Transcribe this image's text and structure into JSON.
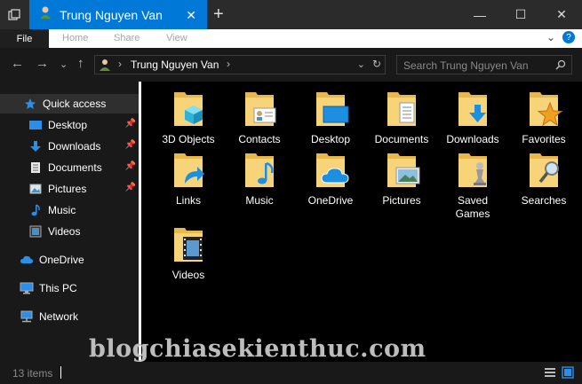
{
  "window": {
    "tab_title": "Trung Nguyen Van",
    "tab_close": "✕",
    "new_tab": "+",
    "minimize": "—",
    "maximize": "☐",
    "close": "✕"
  },
  "ribbon": {
    "file": "File",
    "home": "Home",
    "share": "Share",
    "view": "View",
    "expand_glyph": "⌄",
    "help_glyph": "?"
  },
  "navigation": {
    "back": "←",
    "forward": "→",
    "recent": "⌄",
    "up": "↑",
    "address_path": "Trung Nguyen Van",
    "address_chevron": "›",
    "search_placeholder": "Search Trung Nguyen Van"
  },
  "sidebar": {
    "items": [
      {
        "label": "Quick access",
        "icon": "star-icon"
      },
      {
        "label": "Desktop",
        "icon": "desktop-icon",
        "pinned": true
      },
      {
        "label": "Downloads",
        "icon": "download-icon",
        "pinned": true
      },
      {
        "label": "Documents",
        "icon": "document-icon",
        "pinned": true
      },
      {
        "label": "Pictures",
        "icon": "picture-icon",
        "pinned": true
      },
      {
        "label": "Music",
        "icon": "music-icon"
      },
      {
        "label": "Videos",
        "icon": "video-icon"
      },
      {
        "label": "OneDrive",
        "icon": "cloud-icon"
      },
      {
        "label": "This PC",
        "icon": "computer-icon"
      },
      {
        "label": "Network",
        "icon": "network-icon"
      }
    ]
  },
  "content": {
    "items": [
      {
        "label": "3D Objects",
        "icon": "3d-objects-folder-icon"
      },
      {
        "label": "Contacts",
        "icon": "contacts-folder-icon"
      },
      {
        "label": "Desktop",
        "icon": "desktop-folder-icon"
      },
      {
        "label": "Documents",
        "icon": "documents-folder-icon"
      },
      {
        "label": "Downloads",
        "icon": "downloads-folder-icon"
      },
      {
        "label": "Favorites",
        "icon": "favorites-folder-icon"
      },
      {
        "label": "Links",
        "icon": "links-folder-icon"
      },
      {
        "label": "Music",
        "icon": "music-folder-icon"
      },
      {
        "label": "OneDrive",
        "icon": "onedrive-folder-icon"
      },
      {
        "label": "Pictures",
        "icon": "pictures-folder-icon"
      },
      {
        "label": "Saved Games",
        "icon": "saved-games-folder-icon"
      },
      {
        "label": "Searches",
        "icon": "searches-folder-icon"
      },
      {
        "label": "Videos",
        "icon": "videos-folder-icon"
      }
    ]
  },
  "status": {
    "count": "13 items"
  },
  "watermark": "blogchiasekienthuc.com",
  "colors": {
    "accent": "#0078d7",
    "folder": "#f2c75c",
    "background": "#191919"
  }
}
